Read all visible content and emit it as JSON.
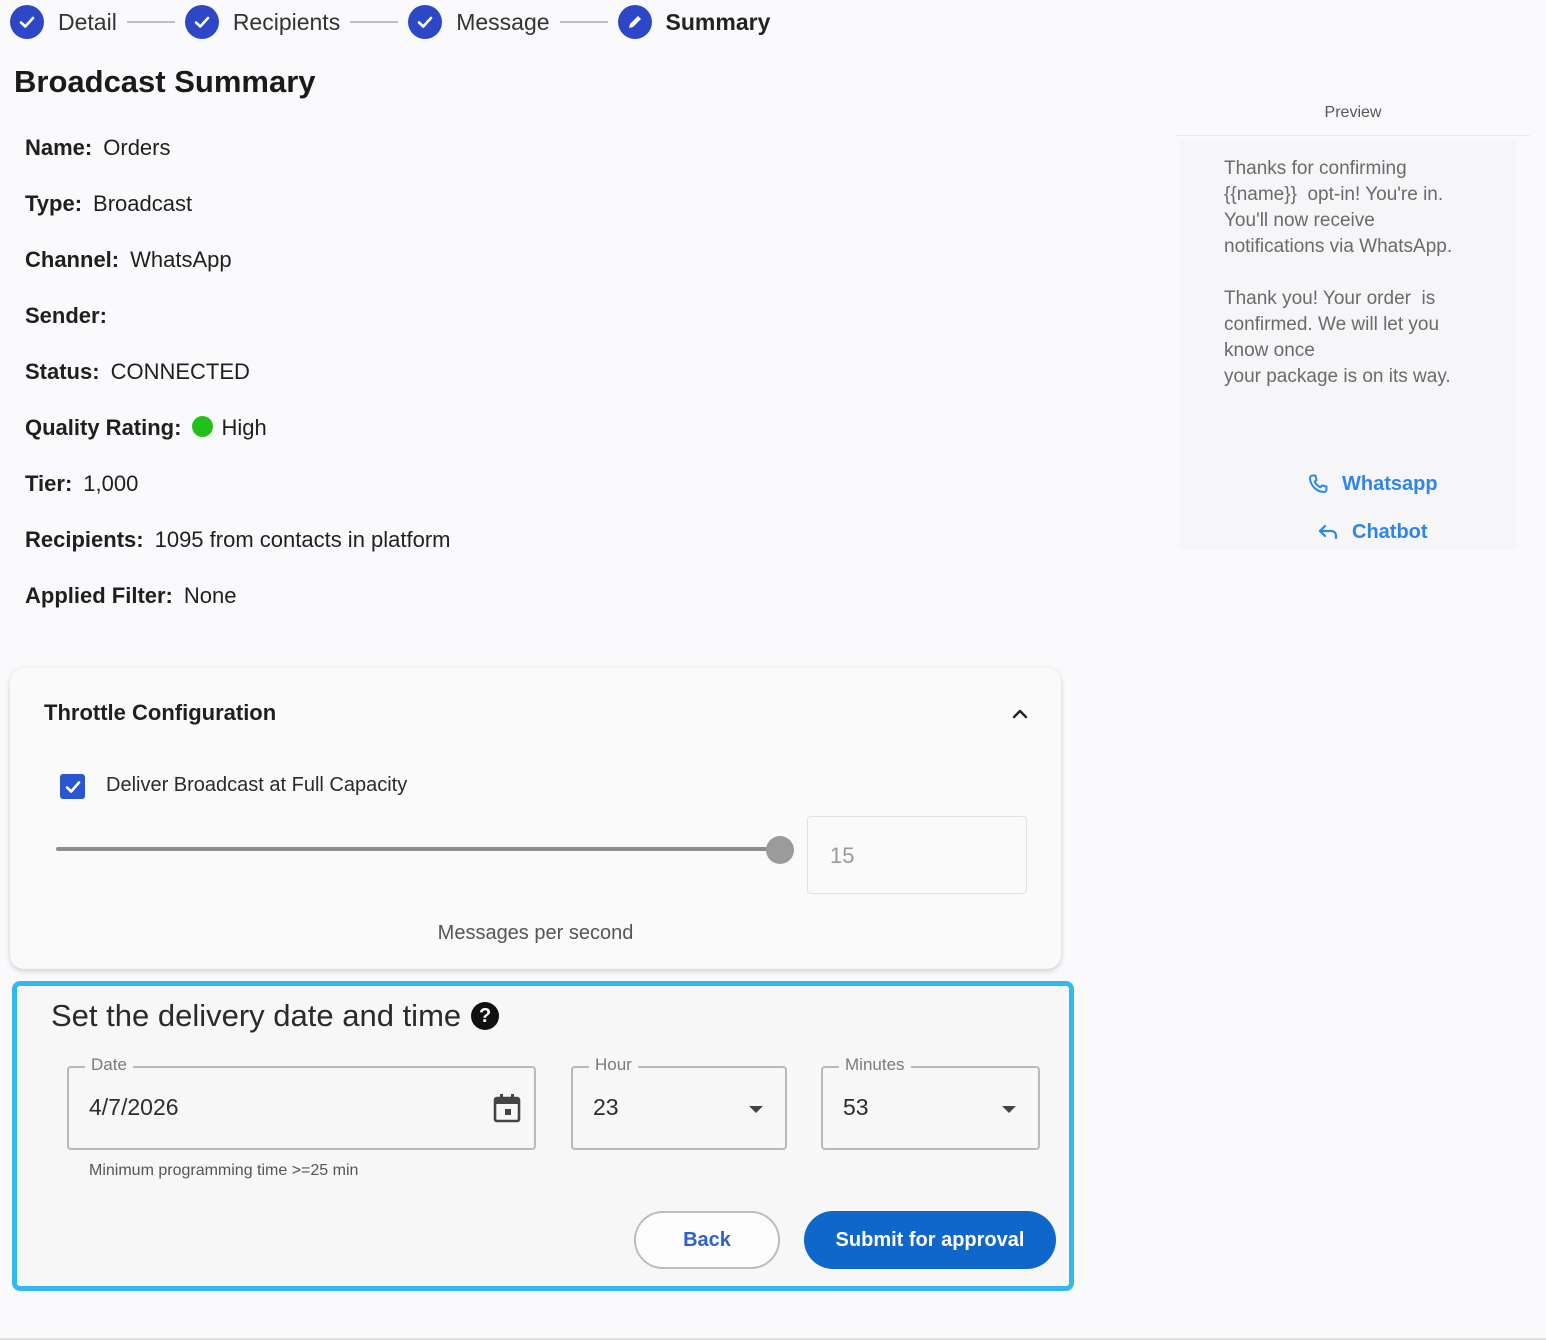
{
  "stepper": {
    "steps": [
      {
        "label": "Detail",
        "state": "done"
      },
      {
        "label": "Recipients",
        "state": "done"
      },
      {
        "label": "Message",
        "state": "done"
      },
      {
        "label": "Summary",
        "state": "active"
      }
    ]
  },
  "page_title": "Broadcast Summary",
  "details": [
    {
      "key": "Name:",
      "value": "Orders"
    },
    {
      "key": "Type:",
      "value": "Broadcast"
    },
    {
      "key": "Channel:",
      "value": "WhatsApp"
    },
    {
      "key": "Sender:",
      "value": ""
    },
    {
      "key": "Status:",
      "value": "CONNECTED"
    },
    {
      "key": "Quality Rating:",
      "value": "High",
      "status_color": "#22c01a"
    },
    {
      "key": "Tier:",
      "value": "1,000"
    },
    {
      "key": "Recipients:",
      "value": "1095 from contacts in platform"
    },
    {
      "key": "Applied Filter:",
      "value": "None"
    }
  ],
  "preview": {
    "header": "Preview",
    "message": "Thanks for confirming\n{{name}}  opt-in! You're in.\nYou'll now receive\nnotifications via WhatsApp.\n\nThank you! Your order  is\nconfirmed. We will let you\nknow once\nyour package is on its way.",
    "buttons": [
      {
        "label": "Whatsapp",
        "icon": "phone-icon"
      },
      {
        "label": "Chatbot",
        "icon": "reply-icon"
      }
    ]
  },
  "throttle": {
    "title": "Throttle Configuration",
    "checkbox_label": "Deliver Broadcast at Full Capacity",
    "checked": true,
    "rate_value": "15",
    "slider_level": 1.0,
    "unit_label": "Messages per second"
  },
  "delivery": {
    "title": "Set the delivery date and time",
    "date": {
      "label": "Date",
      "value": "4/7/2026"
    },
    "hour": {
      "label": "Hour",
      "value": "23"
    },
    "minutes": {
      "label": "Minutes",
      "value": "53"
    },
    "hint": "Minimum programming time >=25 min",
    "back_label": "Back",
    "submit_label": "Submit for approval"
  },
  "colors": {
    "accent": "#2d47c7",
    "primary_button": "#0f67cc",
    "highlight_border": "#33b8f0",
    "link": "#2f86e6"
  }
}
